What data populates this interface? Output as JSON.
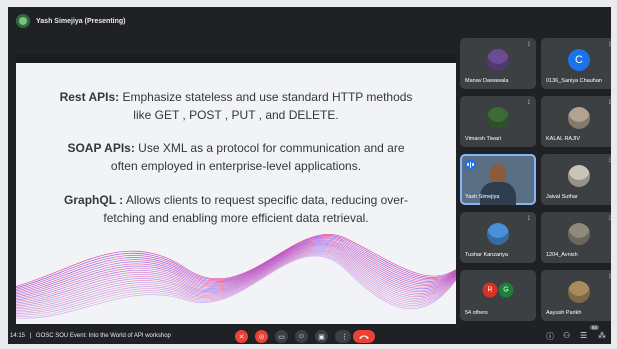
{
  "presenter": {
    "label": "Yash Simejiya (Presenting)"
  },
  "slide": {
    "lines": [
      {
        "term": "Rest APIs:",
        "text": " Emphasize  stateless and use standard HTTP methods"
      },
      {
        "text": "like GET , POST , PUT , and DELETE."
      },
      {
        "term": "SOAP APIs:",
        "text": " Use XML as a protocol for communication and are"
      },
      {
        "text": "often employed in enterprise-level applications."
      },
      {
        "term": "GraphQL :",
        "text": " Allows clients to request specific data, reducing over-"
      },
      {
        "text": "fetching and enabling more efficient data retrieval."
      }
    ],
    "colors": {
      "text": "#33363b",
      "wave_a": "#e8308a",
      "wave_b": "#7a3ef0"
    }
  },
  "participants": [
    {
      "name": "Manav Dawawala",
      "avatar": "photo-avatar",
      "pinned": true
    },
    {
      "name": "0136_Saniya Chauhan",
      "avatar": "letter-avatar",
      "letter": "C",
      "color": "#1a73e8",
      "pinned": true
    },
    {
      "name": "Vimarsh Tiwari",
      "avatar": "photo-avatar",
      "pinned": true
    },
    {
      "name": "KALAL RAJIV",
      "avatar": "photo-avatar",
      "pinned": true
    },
    {
      "name": "Yash Simejiya",
      "avatar": "video-feed",
      "speaking": true,
      "pinned": false
    },
    {
      "name": "Jaival Suthar",
      "avatar": "photo-avatar",
      "pinned": true
    },
    {
      "name": "Tushar Kanzariya",
      "avatar": "photo-avatar",
      "pinned": true
    },
    {
      "name": "1204_Avnish",
      "avatar": "photo-avatar",
      "pinned": true
    },
    {
      "name": "54 others",
      "avatar": "group-avatars",
      "letters": [
        "R",
        "G"
      ],
      "pinned": false
    },
    {
      "name": "Aayush Parikh",
      "avatar": "photo-avatar",
      "pinned": true
    }
  ],
  "meeting": {
    "time": "14:15",
    "separator": "|",
    "title": "GOSC SOU Event: Into the World of API workshop",
    "participant_count": "64"
  },
  "controls": [
    {
      "name": "mic-off-icon",
      "glyph": "✕",
      "red": true
    },
    {
      "name": "camera-off-icon",
      "glyph": "⊘",
      "red": true
    },
    {
      "name": "captions-icon",
      "glyph": "▭",
      "red": false
    },
    {
      "name": "emoji-icon",
      "glyph": "☺",
      "red": false
    },
    {
      "name": "present-icon",
      "glyph": "▣",
      "red": false
    },
    {
      "name": "raise-hand-icon",
      "glyph": "✋",
      "red": false
    },
    {
      "name": "more-options-icon",
      "glyph": "⋮",
      "red": false
    }
  ],
  "right_controls": [
    {
      "name": "info-icon",
      "glyph": "ⓘ"
    },
    {
      "name": "people-icon",
      "glyph": "⚇"
    },
    {
      "name": "chat-icon",
      "glyph": "☰"
    },
    {
      "name": "activities-icon",
      "glyph": "⁂"
    }
  ]
}
